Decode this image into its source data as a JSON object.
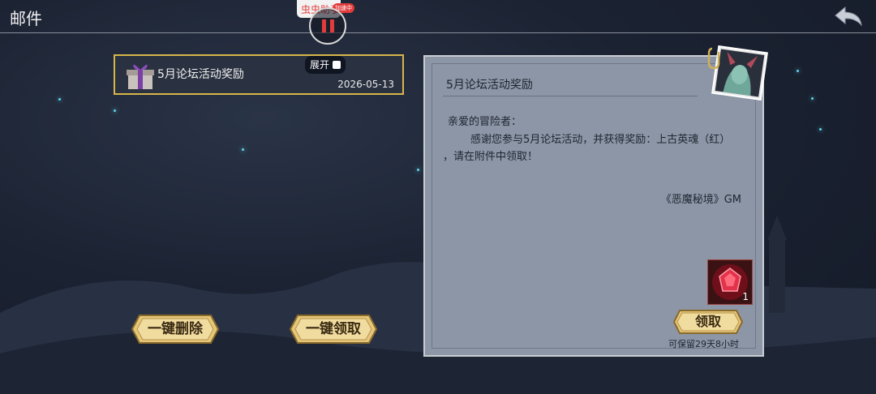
{
  "header": {
    "title": "邮件",
    "overlay_label": "虫虫助手",
    "overlay_tag": "加速中"
  },
  "mail_list": [
    {
      "subject": "5月论坛活动奖励",
      "date": "2026-05-13",
      "icon": "gift-box-icon"
    }
  ],
  "expand_label": "展开",
  "actions": {
    "delete_all": "一键删除",
    "claim_all": "一键领取"
  },
  "letter": {
    "title": "5月论坛活动奖励",
    "greeting": "亲爱的冒险者：",
    "body_line1": "感谢您参与5月论坛活动，并获得奖励：上古英魂（红）",
    "body_line2": "，请在附件中领取！",
    "signature": "《恶魔秘境》GM",
    "attachment": {
      "icon": "red-gem-icon",
      "count": "1"
    },
    "claim_label": "领取",
    "keep_time": "可保留29天8小时"
  },
  "colors": {
    "accent_gold": "#d8b64a",
    "paper": "#8c96a6",
    "background": "#1b2232"
  }
}
